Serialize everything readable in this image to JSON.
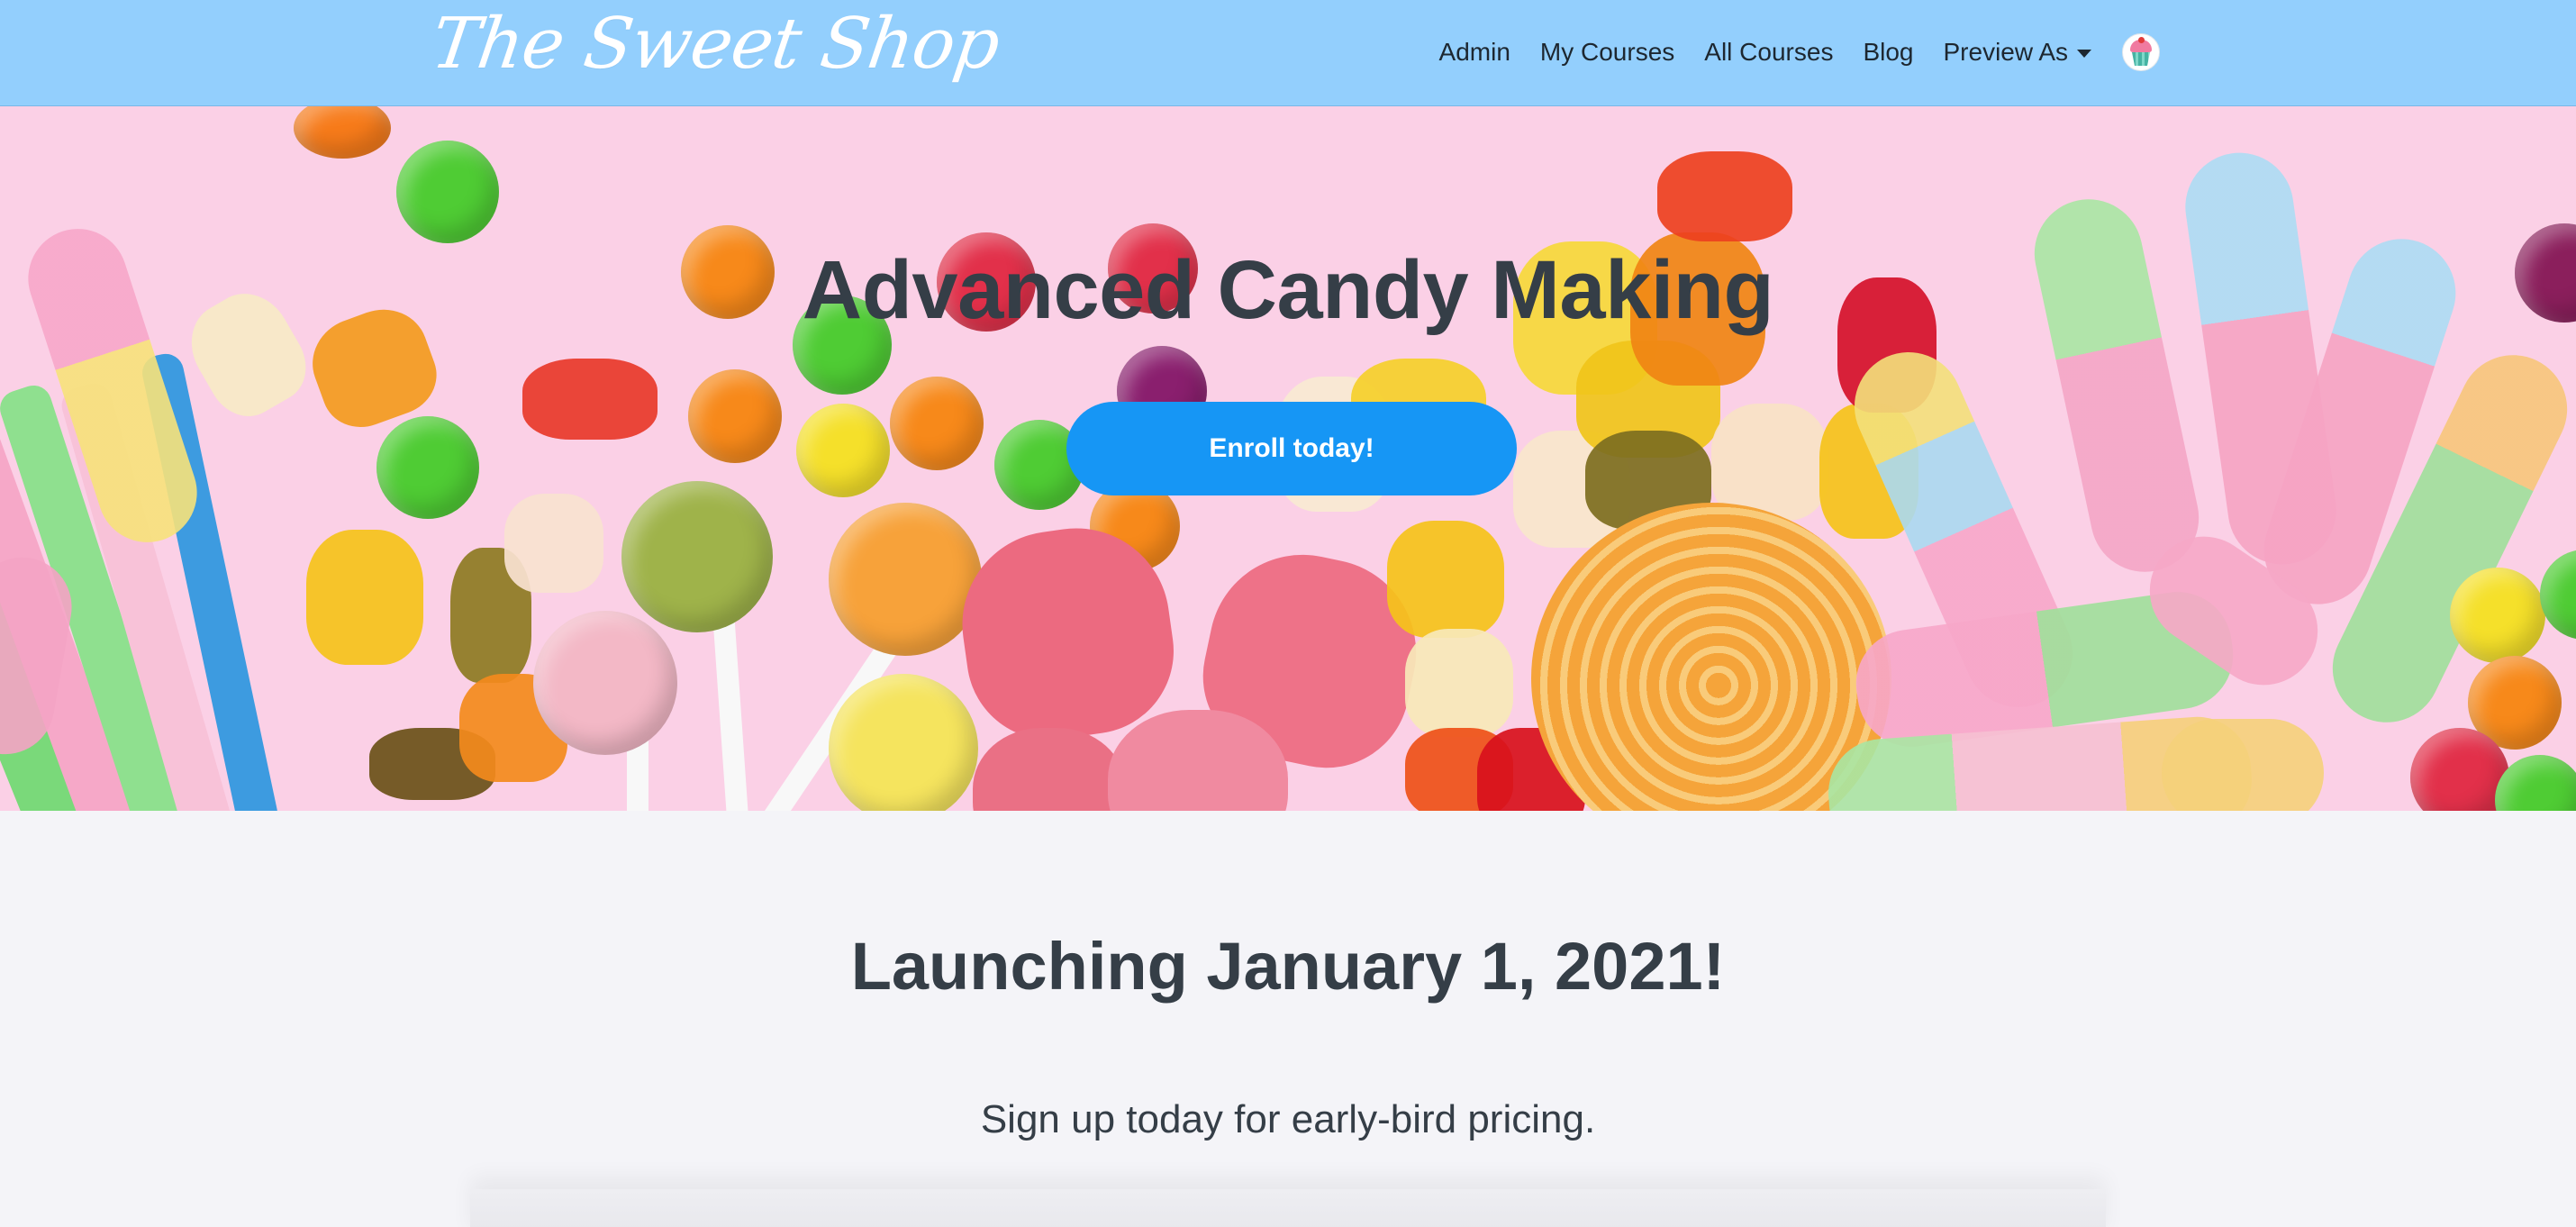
{
  "navbar": {
    "logo_text": "The Sweet Shop",
    "links": [
      "Admin",
      "My Courses",
      "All Courses",
      "Blog"
    ],
    "preview_label": "Preview As",
    "avatar_icon": "cupcake-icon",
    "background": "#93cffd"
  },
  "hero": {
    "title": "Advanced Candy Making",
    "cta_label": "Enroll today!",
    "cta_color": "#1696f5",
    "image": "colorful-candy-background"
  },
  "content": {
    "headline": "Launching January 1, 2021!",
    "subtext": "Sign up today for early-bird pricing."
  }
}
